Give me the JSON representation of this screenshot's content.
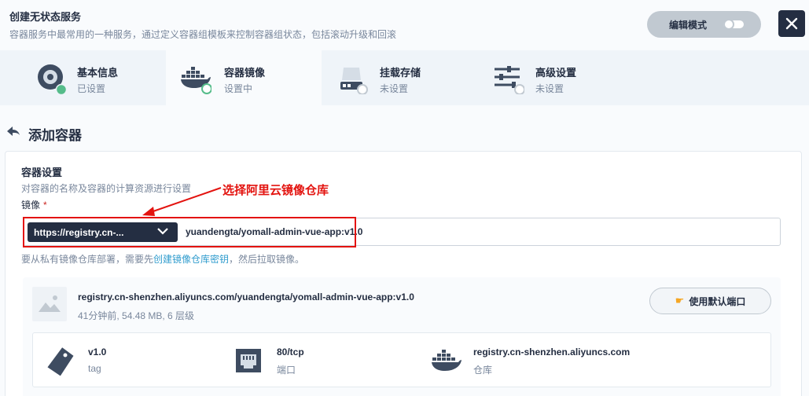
{
  "header": {
    "title": "创建无状态服务",
    "description": "容器服务中最常用的一种服务，通过定义容器组模板来控制容器组状态，包括滚动升级和回滚",
    "edit_mode_label": "编辑模式"
  },
  "steps": [
    {
      "label": "基本信息",
      "status": "已设置",
      "icon": "disc-icon"
    },
    {
      "label": "容器镜像",
      "status": "设置中",
      "icon": "docker-icon"
    },
    {
      "label": "挂载存储",
      "status": "未设置",
      "icon": "storage-icon"
    },
    {
      "label": "高级设置",
      "status": "未设置",
      "icon": "sliders-icon"
    }
  ],
  "page": {
    "title": "添加容器"
  },
  "container_settings": {
    "title": "容器设置",
    "description": "对容器的名称及容器的计算资源进行设置",
    "annotation": "选择阿里云镜像仓库",
    "image_label": "镜像",
    "required_mark": "*",
    "registry_selected": "https://registry.cn-...",
    "image_value": "yuandengta/yomall-admin-vue-app:v1.0",
    "help_prefix": "要从私有镜像仓库部署，需要先",
    "help_link": "创建镜像仓库密钥",
    "help_suffix": "，然后拉取镜像。"
  },
  "image_card": {
    "name": "registry.cn-shenzhen.aliyuncs.com/yuandengta/yomall-admin-vue-app:v1.0",
    "meta": "41分钟前, 54.48 MB, 6 层级",
    "default_port_button": "使用默认端口",
    "details": [
      {
        "value": "v1.0",
        "label": "tag",
        "icon": "tag-icon"
      },
      {
        "value": "80/tcp",
        "label": "端口",
        "icon": "port-icon"
      },
      {
        "value": "registry.cn-shenzhen.aliyuncs.com",
        "label": "仓库",
        "icon": "docker-icon"
      }
    ]
  },
  "colors": {
    "dark": "#242e42",
    "annotation_red": "#e3130f",
    "status_green": "#55bc8a",
    "link": "#329dce"
  }
}
